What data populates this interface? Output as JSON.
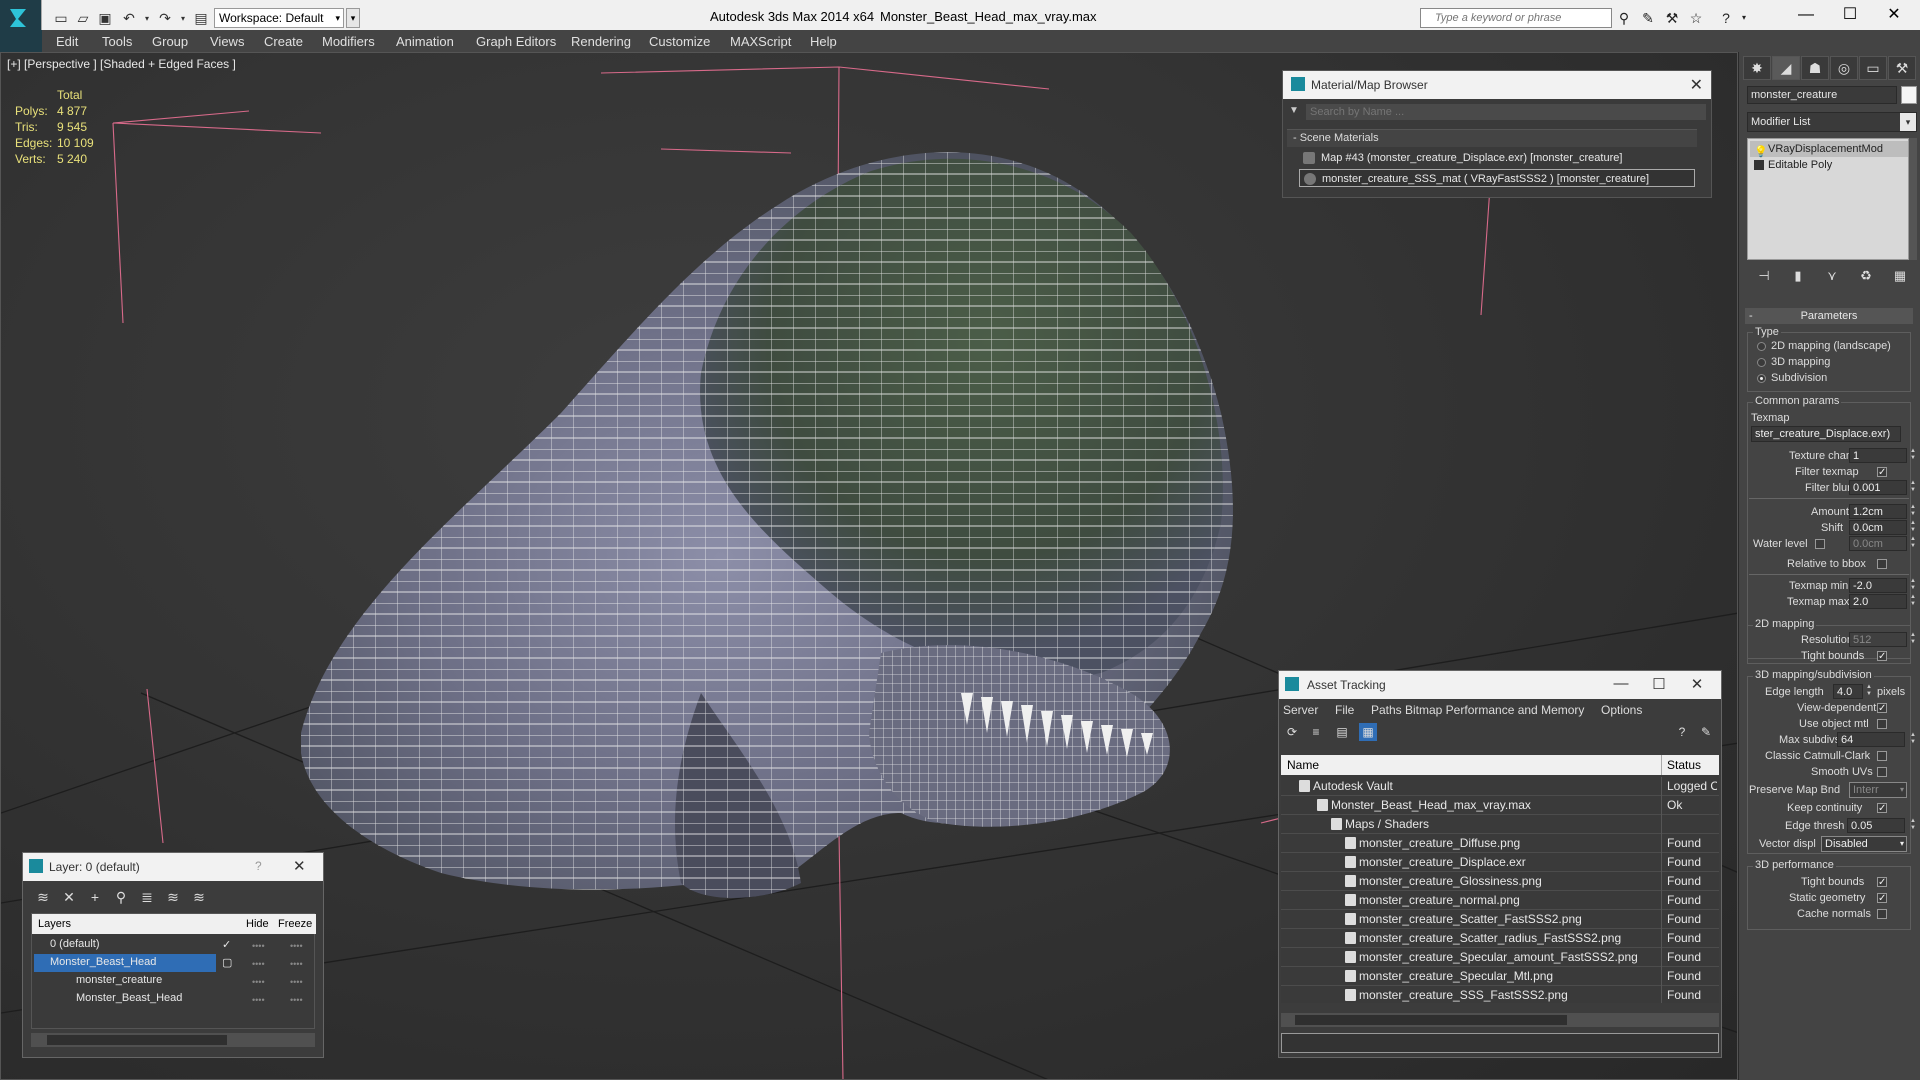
{
  "titlebar": {
    "workspace": "Workspace: Default",
    "app_title": "Autodesk 3ds Max  2014 x64",
    "file_title": "Monster_Beast_Head_max_vray.max",
    "search_placeholder": "Type a keyword or phrase"
  },
  "menu": [
    "Edit",
    "Tools",
    "Group",
    "Views",
    "Create",
    "Modifiers",
    "Animation",
    "Graph Editors",
    "Rendering",
    "Customize",
    "MAXScript",
    "Help"
  ],
  "viewport": {
    "label": "[+] [Perspective ] [Shaded + Edged Faces ]",
    "stats": {
      "total_label": "Total",
      "rows": [
        {
          "key": "Polys:",
          "value": "4 877"
        },
        {
          "key": "Tris:",
          "value": "9 545"
        },
        {
          "key": "Edges:",
          "value": "10 109"
        },
        {
          "key": "Verts:",
          "value": "5 240"
        }
      ]
    }
  },
  "material_browser": {
    "title": "Material/Map Browser",
    "search_placeholder": "Search by Name ...",
    "section": "- Scene Materials",
    "items": [
      "Map #43 (monster_creature_Displace.exr)  [monster_creature]",
      "monster_creature_SSS_mat  ( VRayFastSSS2 )  [monster_creature]"
    ]
  },
  "command_panel": {
    "object_name": "monster_creature",
    "modifier_list": "Modifier List",
    "stack": [
      "VRayDisplacementMod",
      "Editable Poly"
    ],
    "rollout": "Parameters",
    "type_label": "Type",
    "type_options": [
      "2D mapping (landscape)",
      "3D mapping",
      "Subdivision"
    ],
    "common_params": "Common params",
    "texmap_label": "Texmap",
    "texmap_value": "ster_creature_Displace.exr)",
    "texture_chan_label": "Texture chan",
    "texture_chan": "1",
    "filter_texmap": "Filter texmap",
    "filter_blur_label": "Filter blur",
    "filter_blur": "0.001",
    "amount_label": "Amount",
    "amount": "1.2cm",
    "shift_label": "Shift",
    "shift": "0.0cm",
    "water_level_label": "Water level",
    "water_level": "0.0cm",
    "relative_bbox": "Relative to bbox",
    "texmap_min_label": "Texmap min",
    "texmap_min": "-2.0",
    "texmap_max_label": "Texmap max",
    "texmap_max": "2.0",
    "mapping2d": "2D mapping",
    "resolution_label": "Resolution",
    "resolution": "512",
    "tight_bounds": "Tight bounds",
    "mapping3d": "3D mapping/subdivision",
    "edge_length_label": "Edge length",
    "edge_length": "4.0",
    "pixels": "pixels",
    "view_dependent": "View-dependent",
    "use_object_mtl": "Use object mtl",
    "max_subdivs_label": "Max subdivs",
    "max_subdivs": "64",
    "classic_catmull": "Classic Catmull-Clark",
    "smooth_uvs": "Smooth UVs",
    "preserve_map_label": "Preserve Map Bnd",
    "preserve_map": "Interr",
    "keep_continuity": "Keep continuity",
    "edge_thresh_label": "Edge thresh",
    "edge_thresh": "0.05",
    "vector_displ_label": "Vector displ",
    "vector_displ": "Disabled",
    "perf": "3D performance",
    "tight_bounds2": "Tight bounds",
    "static_geometry": "Static geometry",
    "cache_normals": "Cache normals"
  },
  "asset_tracking": {
    "title": "Asset Tracking",
    "menu": [
      "Server",
      "File",
      "Paths",
      "Bitmap Performance and Memory",
      "Options"
    ],
    "col_name": "Name",
    "col_status": "Status",
    "rows": [
      {
        "name": "Autodesk Vault",
        "status": "Logged Out",
        "indent": 1
      },
      {
        "name": "Monster_Beast_Head_max_vray.max",
        "status": "Ok",
        "indent": 2
      },
      {
        "name": "Maps / Shaders",
        "status": "",
        "indent": 3
      },
      {
        "name": "monster_creature_Diffuse.png",
        "status": "Found",
        "indent": 4
      },
      {
        "name": "monster_creature_Displace.exr",
        "status": "Found",
        "indent": 4
      },
      {
        "name": "monster_creature_Glossiness.png",
        "status": "Found",
        "indent": 4
      },
      {
        "name": "monster_creature_normal.png",
        "status": "Found",
        "indent": 4
      },
      {
        "name": "monster_creature_Scatter_FastSSS2.png",
        "status": "Found",
        "indent": 4
      },
      {
        "name": "monster_creature_Scatter_radius_FastSSS2.png",
        "status": "Found",
        "indent": 4
      },
      {
        "name": "monster_creature_Specular_amount_FastSSS2.png",
        "status": "Found",
        "indent": 4
      },
      {
        "name": "monster_creature_Specular_Mtl.png",
        "status": "Found",
        "indent": 4
      },
      {
        "name": "monster_creature_SSS_FastSSS2.png",
        "status": "Found",
        "indent": 4
      }
    ]
  },
  "layers": {
    "title": "Layer: 0 (default)",
    "help": "?",
    "col_layers": "Layers",
    "col_hide": "Hide",
    "col_freeze": "Freeze",
    "rows": [
      "0 (default)",
      "Monster_Beast_Head",
      "monster_creature",
      "Monster_Beast_Head"
    ]
  }
}
